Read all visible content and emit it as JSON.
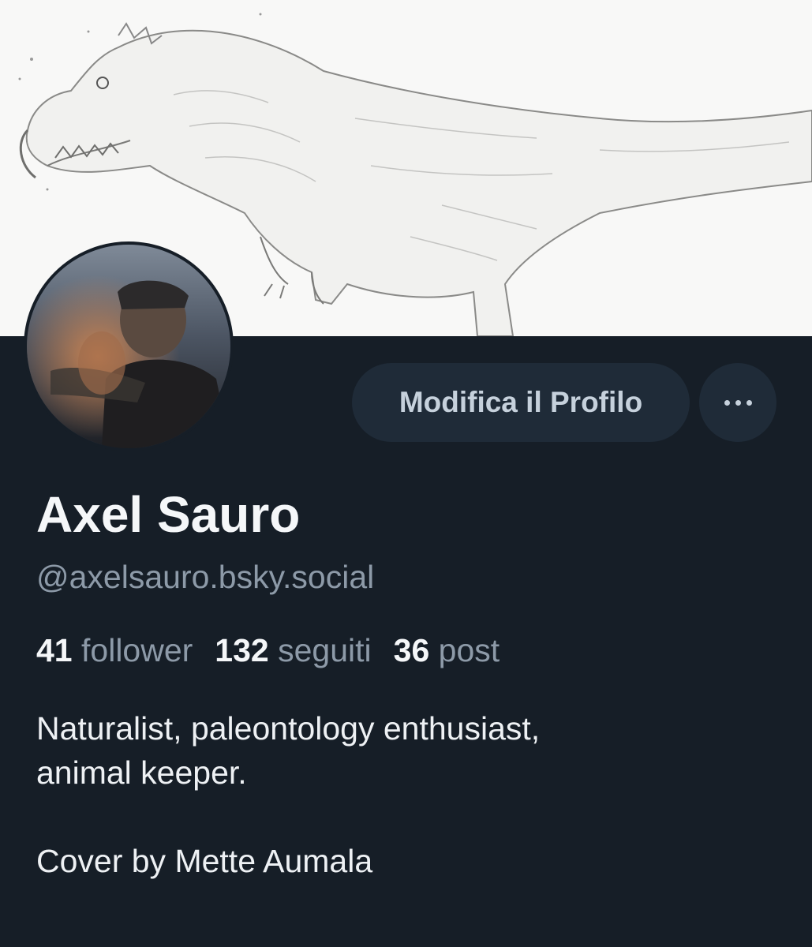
{
  "banner": {
    "alt": "Pencil illustration of a dinosaur"
  },
  "avatar": {
    "alt": "Profile picture"
  },
  "profile": {
    "display_name": "Axel Sauro",
    "handle": "@axelsauro.bsky.social"
  },
  "actions": {
    "edit_label": "Modifica il Profilo",
    "more_icon": "ellipsis-icon"
  },
  "stats": {
    "followers_count": "41",
    "followers_label": "follower",
    "following_count": "132",
    "following_label": "seguiti",
    "posts_count": "36",
    "posts_label": "post"
  },
  "bio": {
    "line1": "Naturalist, paleontology enthusiast,",
    "line2": "animal keeper.",
    "line3": "Cover by Mette Aumala"
  },
  "colors": {
    "background": "#161e27",
    "button_bg": "#1f2b38",
    "button_text": "#c6d1dc",
    "muted_text": "#8d9aa8",
    "primary_text": "#f5f7f9"
  }
}
